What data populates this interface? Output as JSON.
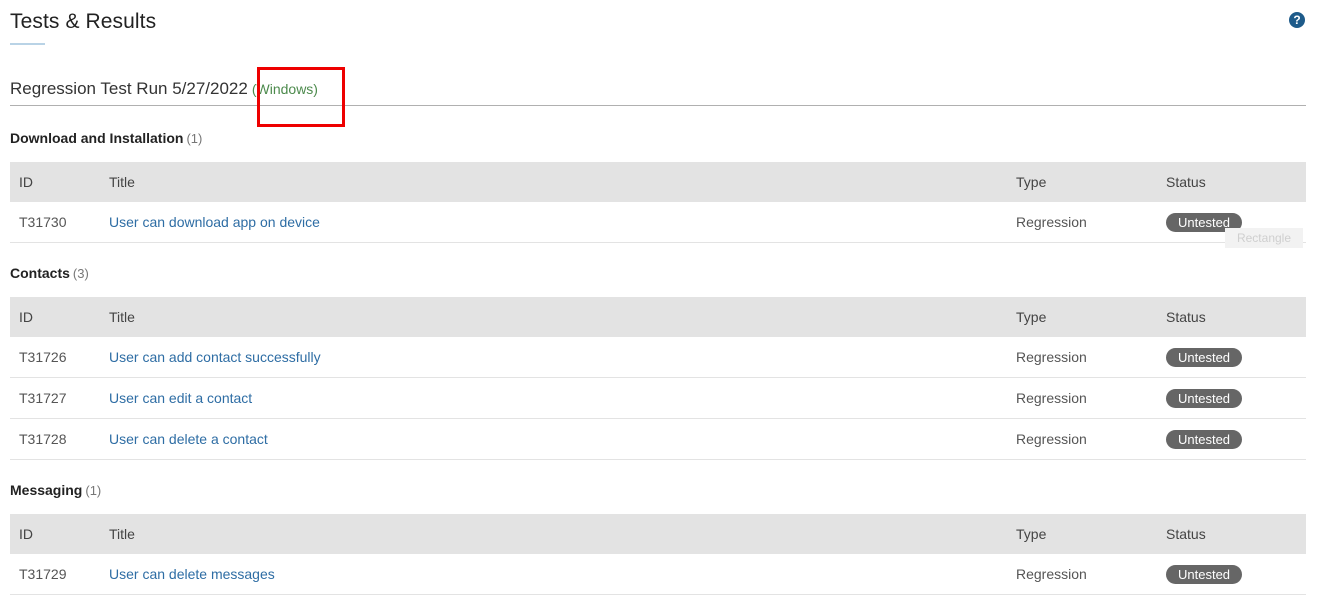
{
  "page": {
    "title": "Tests & Results",
    "help_icon": "question-circle-icon"
  },
  "run": {
    "title": "Regression Test Run 5/27/2022",
    "platform": "(Windows)"
  },
  "overlay": {
    "rect_label": "Rectangle",
    "highlight_color": "#ee0000"
  },
  "columns": {
    "id": "ID",
    "title": "Title",
    "type": "Type",
    "status": "Status"
  },
  "sections": [
    {
      "name": "Download and Installation",
      "count": "(1)",
      "rows": [
        {
          "id": "T31730",
          "title": "User can download app on device",
          "type": "Regression",
          "status": "Untested"
        }
      ]
    },
    {
      "name": "Contacts",
      "count": "(3)",
      "rows": [
        {
          "id": "T31726",
          "title": "User can add contact successfully",
          "type": "Regression",
          "status": "Untested"
        },
        {
          "id": "T31727",
          "title": "User can edit a contact",
          "type": "Regression",
          "status": "Untested"
        },
        {
          "id": "T31728",
          "title": "User can delete a contact",
          "type": "Regression",
          "status": "Untested"
        }
      ]
    },
    {
      "name": "Messaging",
      "count": "(1)",
      "rows": [
        {
          "id": "T31729",
          "title": "User can delete messages",
          "type": "Regression",
          "status": "Untested"
        }
      ]
    }
  ],
  "colors": {
    "link": "#2e6da4",
    "badge": "#666666",
    "platform": "#4c8a4c",
    "header_bg": "#e3e3e3"
  }
}
